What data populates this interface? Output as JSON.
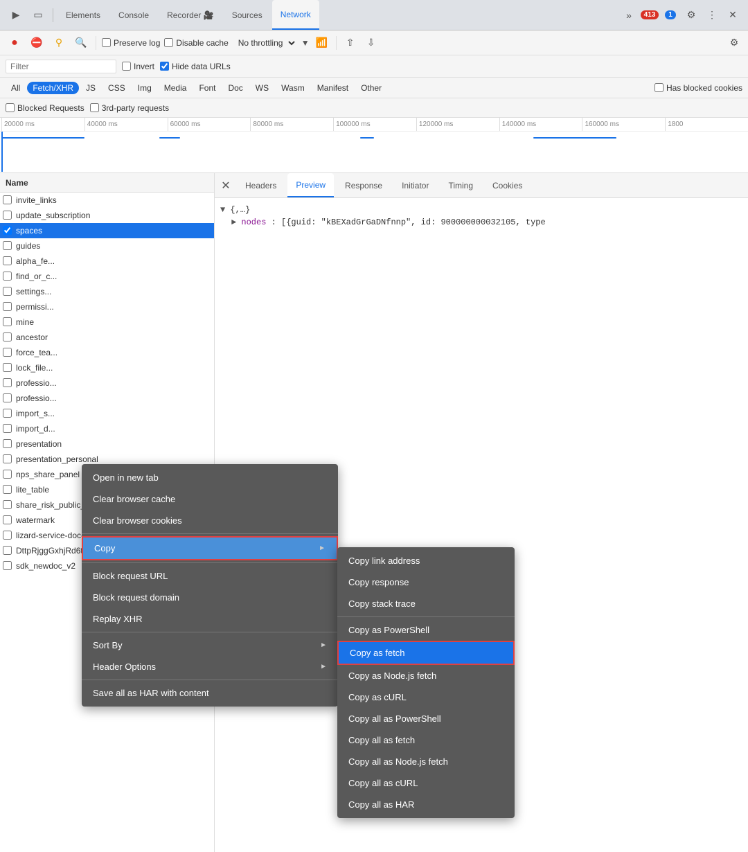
{
  "tabs": {
    "items": [
      {
        "label": "Elements",
        "active": false
      },
      {
        "label": "Console",
        "active": false
      },
      {
        "label": "Recorder 🎥",
        "active": false
      },
      {
        "label": "Sources",
        "active": false
      },
      {
        "label": "Network",
        "active": true
      }
    ],
    "more_label": "»",
    "error_badge": "413",
    "info_badge": "1",
    "gear_label": "⚙",
    "more_btn": "⋮",
    "close_label": "✕"
  },
  "toolbar": {
    "record_tooltip": "Record",
    "stop_tooltip": "Stop",
    "clear_tooltip": "Clear",
    "search_tooltip": "Search",
    "preserve_log": "Preserve log",
    "disable_cache": "Disable cache",
    "throttle_label": "No throttling",
    "upload_tooltip": "Upload",
    "download_tooltip": "Download",
    "settings_tooltip": "Settings"
  },
  "filter_bar": {
    "placeholder": "Filter",
    "invert_label": "Invert",
    "hide_data_urls_label": "Hide data URLs"
  },
  "type_filters": [
    {
      "label": "All",
      "active": false
    },
    {
      "label": "Fetch/XHR",
      "active": true
    },
    {
      "label": "JS",
      "active": false
    },
    {
      "label": "CSS",
      "active": false
    },
    {
      "label": "Img",
      "active": false
    },
    {
      "label": "Media",
      "active": false
    },
    {
      "label": "Font",
      "active": false
    },
    {
      "label": "Doc",
      "active": false
    },
    {
      "label": "WS",
      "active": false
    },
    {
      "label": "Wasm",
      "active": false
    },
    {
      "label": "Manifest",
      "active": false
    },
    {
      "label": "Other",
      "active": false
    }
  ],
  "blocked_cookies_label": "Has blocked cookies",
  "request_options": {
    "blocked_requests": "Blocked Requests",
    "third_party": "3rd-party requests"
  },
  "timeline": {
    "ticks": [
      "20000 ms",
      "40000 ms",
      "60000 ms",
      "80000 ms",
      "100000 ms",
      "120000 ms",
      "140000 ms",
      "160000 ms",
      "1800"
    ]
  },
  "panel_tabs": [
    "Headers",
    "Preview",
    "Response",
    "Initiator",
    "Timing",
    "Cookies"
  ],
  "active_panel_tab": "Preview",
  "network_list_header": "Name",
  "network_items": [
    {
      "name": "invite_links",
      "selected": false
    },
    {
      "name": "update_subscription",
      "selected": false
    },
    {
      "name": "spaces",
      "selected": true
    },
    {
      "name": "guides",
      "selected": false
    },
    {
      "name": "alpha_fe...",
      "selected": false
    },
    {
      "name": "find_or_c...",
      "selected": false
    },
    {
      "name": "settings...",
      "selected": false
    },
    {
      "name": "permissi...",
      "selected": false
    },
    {
      "name": "mine",
      "selected": false
    },
    {
      "name": "ancestor",
      "selected": false
    },
    {
      "name": "force_tea...",
      "selected": false
    },
    {
      "name": "lock_file...",
      "selected": false
    },
    {
      "name": "professio...",
      "selected": false
    },
    {
      "name": "professio...",
      "selected": false
    },
    {
      "name": "import_s...",
      "selected": false
    },
    {
      "name": "import_d...",
      "selected": false
    },
    {
      "name": "presentation",
      "selected": false
    },
    {
      "name": "presentation_personal",
      "selected": false
    },
    {
      "name": "nps_share_panel",
      "selected": false
    },
    {
      "name": "lite_table",
      "selected": false
    },
    {
      "name": "share_risk_public_share",
      "selected": false
    },
    {
      "name": "watermark",
      "selected": false
    },
    {
      "name": "lizard-service-doc-sdk",
      "selected": false
    },
    {
      "name": "DttpRjggGxhjRd6t?Expires=1...",
      "selected": false
    },
    {
      "name": "sdk_newdoc_v2",
      "selected": false
    }
  ],
  "json_preview": {
    "root": "{,…}",
    "nodes_label": "nodes",
    "nodes_value": "[{guid: \"kBEXadGrGaDNfnnp\", id: 900000000032105, type"
  },
  "context_menu": {
    "items": [
      {
        "label": "Open in new tab",
        "type": "item",
        "has_sub": false
      },
      {
        "label": "Clear browser cache",
        "type": "item",
        "has_sub": false
      },
      {
        "label": "Clear browser cookies",
        "type": "item",
        "has_sub": false
      },
      {
        "type": "sep"
      },
      {
        "label": "Copy",
        "type": "item",
        "has_sub": true,
        "highlighted": true
      },
      {
        "type": "sep"
      },
      {
        "label": "Block request URL",
        "type": "item",
        "has_sub": false
      },
      {
        "label": "Block request domain",
        "type": "item",
        "has_sub": false
      },
      {
        "label": "Replay XHR",
        "type": "item",
        "has_sub": false
      },
      {
        "type": "sep"
      },
      {
        "label": "Sort By",
        "type": "item",
        "has_sub": true
      },
      {
        "label": "Header Options",
        "type": "item",
        "has_sub": true
      },
      {
        "type": "sep"
      },
      {
        "label": "Save all as HAR with content",
        "type": "item",
        "has_sub": false
      }
    ]
  },
  "submenu": {
    "items": [
      {
        "label": "Copy link address",
        "type": "item"
      },
      {
        "label": "Copy response",
        "type": "item"
      },
      {
        "label": "Copy stack trace",
        "type": "item"
      },
      {
        "type": "sep"
      },
      {
        "label": "Copy as PowerShell",
        "type": "item"
      },
      {
        "label": "Copy as fetch",
        "type": "item",
        "active": true
      },
      {
        "label": "Copy as Node.js fetch",
        "type": "item"
      },
      {
        "label": "Copy as cURL",
        "type": "item"
      },
      {
        "label": "Copy all as PowerShell",
        "type": "item"
      },
      {
        "label": "Copy all as fetch",
        "type": "item"
      },
      {
        "label": "Copy all as Node.js fetch",
        "type": "item"
      },
      {
        "label": "Copy all as cURL",
        "type": "item"
      },
      {
        "label": "Copy all as HAR",
        "type": "item"
      }
    ]
  }
}
